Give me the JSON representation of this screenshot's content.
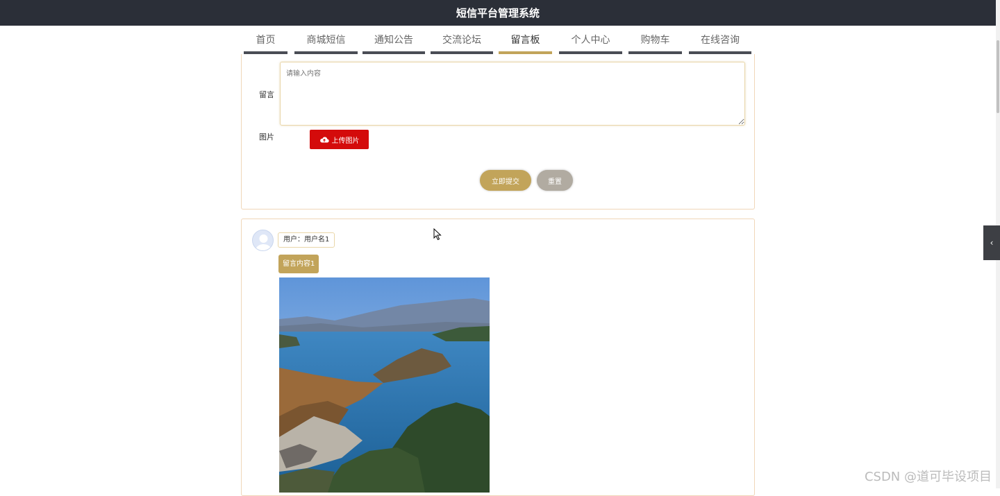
{
  "header": {
    "title": "短信平台管理系统"
  },
  "nav": {
    "items": [
      {
        "label": "首页"
      },
      {
        "label": "商城短信"
      },
      {
        "label": "通知公告"
      },
      {
        "label": "交流论坛"
      },
      {
        "label": "留言板",
        "active": true
      },
      {
        "label": "个人中心"
      },
      {
        "label": "购物车"
      },
      {
        "label": "在线咨询"
      }
    ]
  },
  "form": {
    "message_label": "留言",
    "message_placeholder": "请输入内容",
    "image_label": "图片",
    "upload_label": "上传图片",
    "submit_label": "立即提交",
    "reset_label": "重置"
  },
  "messages": [
    {
      "user": "用户：用户名1",
      "content": "留言内容1",
      "image": "lake-landscape-photo"
    }
  ],
  "watermark": "CSDN @道可毕设项目",
  "colors": {
    "accent": "#c2a45a",
    "header_bg": "#2b2f38",
    "upload_red": "#d40b0b",
    "card_border": "#f0d6b8"
  }
}
